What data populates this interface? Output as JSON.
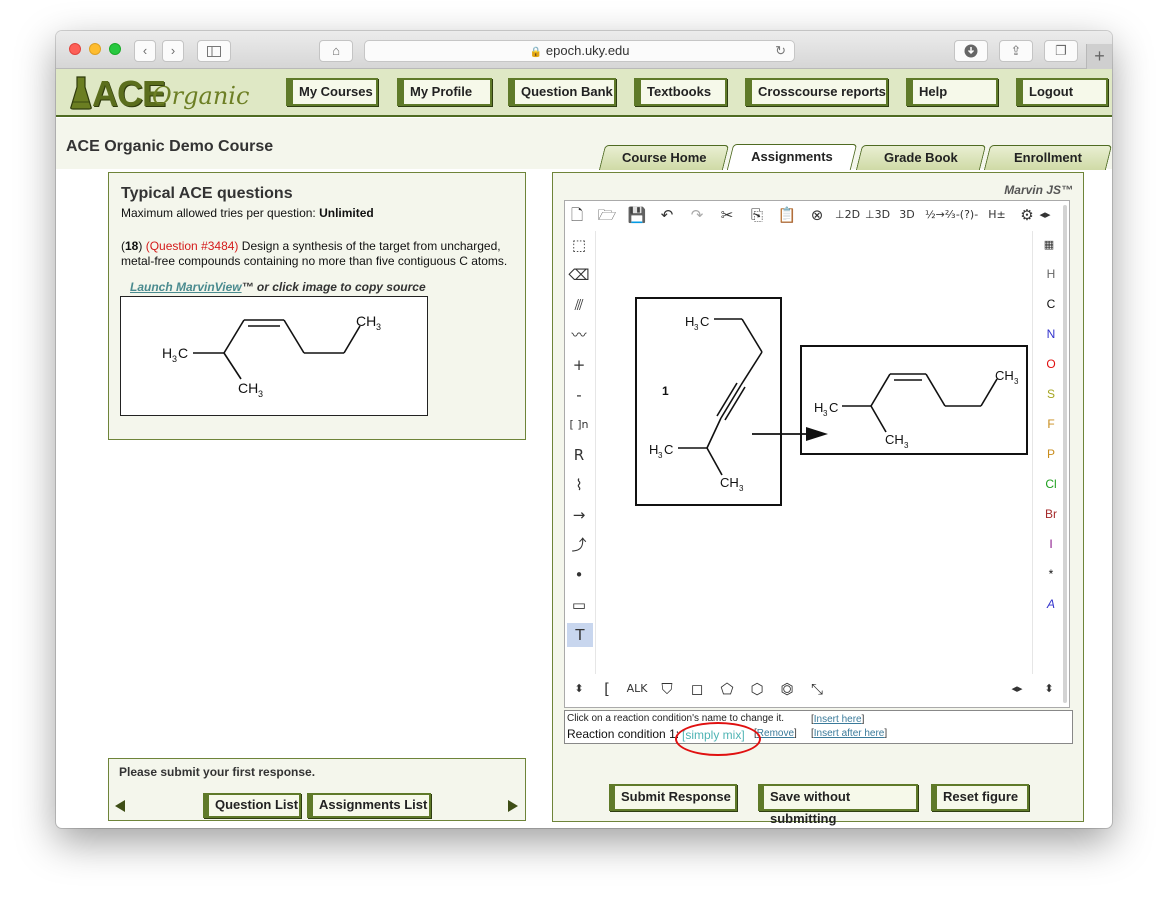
{
  "browser": {
    "url": "epoch.uky.edu"
  },
  "nav": {
    "my_courses": "My Courses",
    "my_profile": "My Profile",
    "question_bank": "Question Bank",
    "textbooks": "Textbooks",
    "crosscourse_reports": "Crosscourse reports",
    "help": "Help",
    "logout": "Logout"
  },
  "course": {
    "title": "ACE Organic Demo Course"
  },
  "tabs": {
    "course_home": "Course Home",
    "assignments": "Assignments",
    "grade_book": "Grade Book",
    "enrollment": "Enrollment"
  },
  "question": {
    "heading": "Typical ACE questions",
    "tries_label": "Maximum allowed tries per question: ",
    "tries_value": "Unlimited",
    "number": "18",
    "qid": "(Question #3484)",
    "text": " Design a synthesis of the target from uncharged, metal-free compounds containing no more than five contiguous C atoms.",
    "launch_link": "Launch MarvinView",
    "launch_suffix": "™ or click image to copy source"
  },
  "submit_panel": {
    "message": "Please submit your first response.",
    "question_list": "Question List",
    "assignments_list": "Assignments List"
  },
  "marvin": {
    "label": "Marvin JS™",
    "step_number": "1",
    "elements": [
      "H",
      "C",
      "N",
      "O",
      "S",
      "F",
      "P",
      "Cl",
      "Br",
      "I",
      "*",
      "A"
    ],
    "element_colors": {
      "H": "#666666",
      "C": "#111111",
      "N": "#3333cc",
      "O": "#e01010",
      "S": "#a5a520",
      "F": "#c88c1c",
      "P": "#c88c1c",
      "Cl": "#20a020",
      "Br": "#a52a2a",
      "I": "#8b1a8b",
      "*": "#111111",
      "A": "#3333cc"
    }
  },
  "condition": {
    "hint": "Click on a reaction condition's name to change it.",
    "label": "Reaction condition 1:",
    "value": "[simply mix]",
    "remove": "Remove",
    "insert_here": "Insert here",
    "insert_after_here": "Insert after here"
  },
  "actions": {
    "submit": "Submit Response",
    "save": "Save without submitting",
    "reset": "Reset figure"
  }
}
